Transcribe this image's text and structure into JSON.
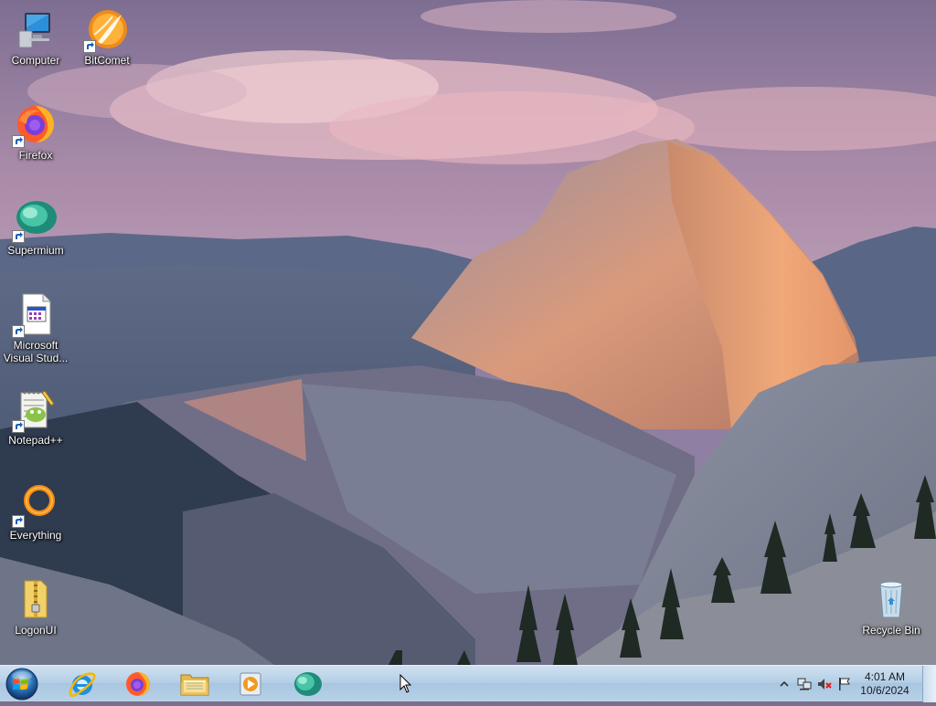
{
  "desktop": {
    "icons": [
      {
        "label": "Computer",
        "icon": "computer-icon"
      },
      {
        "label": "BitComet",
        "icon": "bitcomet-icon"
      },
      {
        "label": "Firefox",
        "icon": "firefox-icon"
      },
      {
        "label": "Supermium",
        "icon": "supermium-icon"
      },
      {
        "label": "Microsoft Visual Stud...",
        "icon": "visual-studio-icon"
      },
      {
        "label": "Notepad++",
        "icon": "notepadpp-icon"
      },
      {
        "label": "Everything",
        "icon": "everything-icon"
      },
      {
        "label": "LogonUI",
        "icon": "zip-folder-icon"
      },
      {
        "label": "Recycle Bin",
        "icon": "recycle-bin-icon"
      }
    ],
    "wallpaper": "Half Dome mountain at sunset"
  },
  "taskbar": {
    "start": {
      "icon": "windows-orb-icon"
    },
    "pinned": [
      {
        "icon": "internet-explorer-icon"
      },
      {
        "icon": "firefox-icon"
      },
      {
        "icon": "file-explorer-icon"
      },
      {
        "icon": "media-player-icon"
      },
      {
        "icon": "supermium-icon"
      }
    ],
    "tray": {
      "icons": [
        "show-hidden-icons-chevron",
        "network-icon",
        "volume-muted-icon",
        "action-center-flag-icon"
      ],
      "time": "4:01 AM",
      "date": "10/6/2024"
    }
  },
  "colors": {
    "taskbar": "#b8d1e8",
    "sky_top": "#7d6e92",
    "sky_glow": "#e9b6c0",
    "rock_lit": "#e8a076"
  }
}
